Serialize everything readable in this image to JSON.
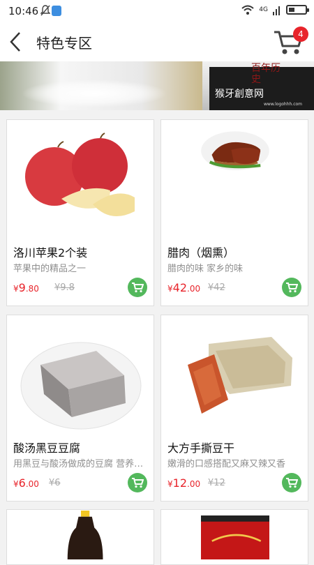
{
  "status": {
    "time": "10:46",
    "net": "4G"
  },
  "nav": {
    "title": "特色专区",
    "cart_count": "4"
  },
  "banner": {
    "brand": "猴牙創意网",
    "site": "www.logohhh.com",
    "stamp": "百年历史"
  },
  "products": [
    {
      "name": "洛川苹果2个装",
      "desc": "苹果中的精品之一",
      "price_int": "9",
      "price_dec": ".80",
      "old_price": "¥9.8"
    },
    {
      "name": "腊肉（烟熏）",
      "desc": "腊肉的味 家乡的味",
      "price_int": "42",
      "price_dec": ".00",
      "old_price": "¥42"
    },
    {
      "name": "酸汤黑豆豆腐",
      "desc": "用黑豆与酸汤做成的豆腐 营养丰富",
      "price_int": "6",
      "price_dec": ".00",
      "old_price": "¥6"
    },
    {
      "name": "大方手撕豆干",
      "desc": "嫩滑的口感搭配又麻又辣又香",
      "price_int": "12",
      "price_dec": ".00",
      "old_price": "¥12"
    }
  ],
  "currency": "¥",
  "colors": {
    "accent": "#e8242b",
    "green": "#53b85c"
  }
}
